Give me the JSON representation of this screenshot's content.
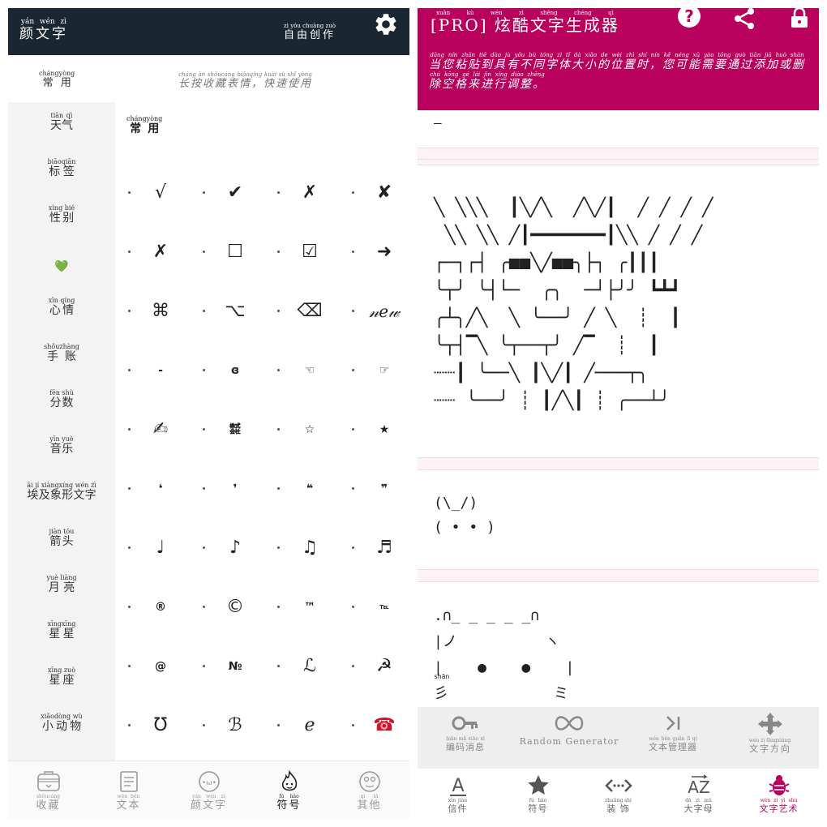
{
  "left": {
    "header": {
      "title": {
        "text": "颜文字",
        "pinyin": "yán wén zì"
      },
      "free_create": {
        "text": "自由创作",
        "pinyin": "zì yóu chuàng zuò"
      },
      "settings_icon": "gear-icon"
    },
    "subheader": {
      "category": {
        "text": "常用",
        "pinyin": "chángyòng"
      },
      "hint": {
        "text": "长按收藏表情，快速使用",
        "pinyin": "cháng àn shōucáng biǎoqíng  kuài sù shǐ yòng"
      }
    },
    "sidebar": [
      {
        "text": "天气",
        "pinyin": "tiān qì"
      },
      {
        "text": "标签",
        "pinyin": "biāoqiān"
      },
      {
        "text": "性别",
        "pinyin": "xìng bié"
      },
      {
        "text": "💚",
        "pinyin": ""
      },
      {
        "text": "心情",
        "pinyin": "xīn qíng"
      },
      {
        "text": "手账",
        "pinyin": "shǒuzhàng"
      },
      {
        "text": "分数",
        "pinyin": "fēn shù"
      },
      {
        "text": "音乐",
        "pinyin": "yīn yuè"
      },
      {
        "text": "埃及象形文字",
        "pinyin": "āi  jí  xiàngxíng wén  zì"
      },
      {
        "text": "箭头",
        "pinyin": "jiàn tóu"
      },
      {
        "text": "月亮",
        "pinyin": "yuè liàng"
      },
      {
        "text": "星星",
        "pinyin": "xīngxīng"
      },
      {
        "text": "星座",
        "pinyin": "xīng zuò"
      },
      {
        "text": "小动物",
        "pinyin": "xiǎodòng wù"
      },
      {
        "text": "",
        "pinyin": ""
      }
    ],
    "main": {
      "section_title": {
        "text": "常用",
        "pinyin": "chángyòng"
      },
      "rows": [
        [
          "√",
          "✔",
          "✗",
          "✘"
        ],
        [
          "✗",
          "☐",
          "☑",
          "➜"
        ],
        [
          "⌘",
          "⌥",
          "⌫",
          "𝓃ℯ𝓌"
        ],
        [
          "-",
          "ɞ",
          "☜",
          "☞"
        ],
        [
          "✍",
          "㍿",
          "☆",
          "★"
        ],
        [
          "❛",
          "❜",
          "❝",
          "❞"
        ],
        [
          "♩",
          "♪",
          "♫",
          "♬"
        ],
        [
          "®",
          "©",
          "™",
          "℡"
        ],
        [
          "@",
          "№",
          "ℒ",
          "☭"
        ],
        [
          "Ʊ",
          "ℬ",
          "ℯ",
          "☎"
        ]
      ]
    },
    "bottom_nav": [
      {
        "text": "收藏",
        "pinyin": "shōucáng",
        "icon": "favorites-box-icon"
      },
      {
        "text": "文本",
        "pinyin": "wén běn",
        "icon": "text-doc-icon"
      },
      {
        "text": "颜文字",
        "pinyin": "yán wén zì",
        "icon": "kaomoji-face-icon"
      },
      {
        "text": "符号",
        "pinyin": "fú hào",
        "icon": "flame-symbol-icon"
      },
      {
        "text": "其他",
        "pinyin": "qí tā",
        "icon": "face-other-icon"
      }
    ]
  },
  "right": {
    "header": {
      "title": {
        "text": "[PRO] 炫酷文字生成器",
        "pinyin": "xuàn kù wén zì shēng chéng qì"
      },
      "icons": [
        "help-icon",
        "share-icon",
        "lock-icon"
      ],
      "note": {
        "text": "当您粘贴到具有不同字体大小的位置时，您可能需要通过添加或删除空格来进行调整。",
        "pinyin": "dāng nín zhān tiē dào jù yǒu bù tóng zì tǐ dà xiǎo de wèi zhì shí  nín kě néng xū yào tōng guò tiān jiā huò shān chú kōng gé lái jìn xíng diào zhěng"
      }
    },
    "content": {
      "art_top": "—",
      "art_big": [
        "╲ ╲╲╲  ┃╲╱╲  ╱╲╱┃  ╱ ╱ ╱ ╱",
        " ╲╲ ╲╲ ╱┃━━━━━━━┃╲╲ ╱ ╱ ╱",
        "┌─┐┌┤ ╭■■╲╱■■╮├┐ ╭┃┃┃",
        "╰┬╯ ╰┤└─  ╭╮  ─┘├╯╯ ┗┻┛",
        "╭┴╮╱╲  ╲ ╰──╯ ╱ ╲  ┊  ┃",
        "╰┬┤▔╲ ╰┬──┬╯ ╱▔  ┊  ┃",
        "┈┈┃ ╰──╲ ┃╲╱┃ ╱───┬╮",
        "┈┈ ╰──╯ ┊ ┃╱╲┃ ┊ ╭──┴╯"
      ],
      "art_mid": [
        "(\\_/)",
        "( • • )"
      ],
      "art_bot": [
        ".∩_ _ _ _ _∩",
        "|ノ          ヽ",
        "|    ●    ●    |",
        "彡            ミ"
      ],
      "art_bot_pinyin": "shān"
    },
    "tools": [
      {
        "text": "编码消息",
        "pinyin": "biān mǎ xiāo xī",
        "icon": "key-icon"
      },
      {
        "text": "Random Generator",
        "pinyin": "",
        "icon": "infinity-icon"
      },
      {
        "text": "文本管理器",
        "pinyin": "wén běn guǎn lǐ qì",
        "icon": "skip-forward-icon"
      },
      {
        "text": "文字方向",
        "pinyin": "wén zì fāngxiàng",
        "icon": "move-arrows-icon"
      }
    ],
    "bottom_nav": [
      {
        "text": "信件",
        "pinyin": "xìn jiàn",
        "icon": "letter-a-icon"
      },
      {
        "text": "符号",
        "pinyin": "fú hào",
        "icon": "star-icon"
      },
      {
        "text": "装饰",
        "pinyin": "zhuāng shì",
        "icon": "dotted-arrows-icon"
      },
      {
        "text": "大字母",
        "pinyin": "dà zì mǔ",
        "icon": "az-letters-icon"
      },
      {
        "text": "文字艺术",
        "pinyin": "wén zì yì shù",
        "icon": "bug-art-icon"
      }
    ],
    "accent": "#b8005c",
    "header_bg": "#1b2633"
  }
}
